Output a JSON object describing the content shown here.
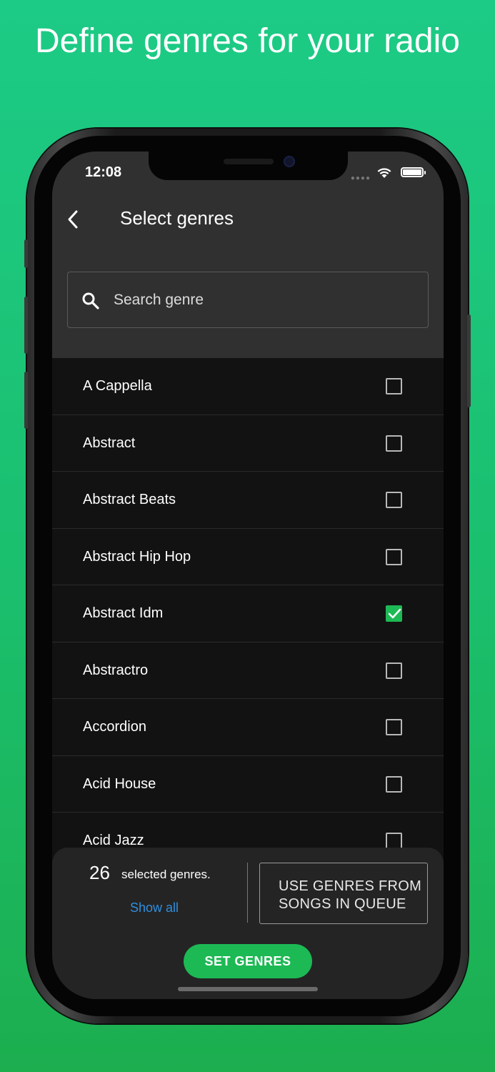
{
  "headline": "Define genres for your radio",
  "status": {
    "time": "12:08"
  },
  "header": {
    "title": "Select genres"
  },
  "search": {
    "placeholder": "Search genre"
  },
  "genres": [
    {
      "label": "A Cappella",
      "checked": false
    },
    {
      "label": "Abstract",
      "checked": false
    },
    {
      "label": "Abstract Beats",
      "checked": false
    },
    {
      "label": "Abstract Hip Hop",
      "checked": false
    },
    {
      "label": "Abstract Idm",
      "checked": true
    },
    {
      "label": "Abstractro",
      "checked": false
    },
    {
      "label": "Accordion",
      "checked": false
    },
    {
      "label": "Acid House",
      "checked": false
    },
    {
      "label": "Acid Jazz",
      "checked": false
    }
  ],
  "footer": {
    "count": "26",
    "count_label": "selected genres.",
    "show_all": "Show all",
    "use_genres": "USE GENRES FROM SONGS IN QUEUE",
    "set_genres": "SET GENRES"
  },
  "colors": {
    "accent": "#1db954",
    "link": "#2f8fe0",
    "background_green": "#1bbf6d"
  }
}
